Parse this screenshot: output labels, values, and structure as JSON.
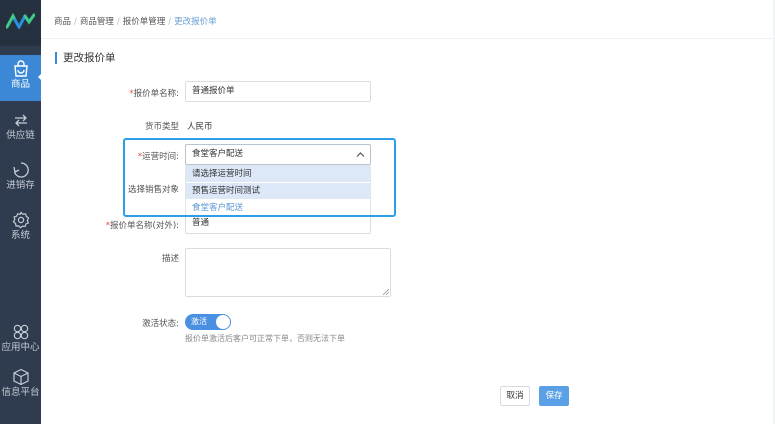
{
  "sidebar": {
    "items": [
      {
        "label": "商品",
        "icon": "shopping-bag-icon",
        "active": true
      },
      {
        "label": "供应链",
        "icon": "exchange-arrows-icon",
        "active": false
      },
      {
        "label": "进销存",
        "icon": "cycle-icon",
        "active": false
      },
      {
        "label": "系统",
        "icon": "gear-icon",
        "active": false
      },
      {
        "label": "应用中心",
        "icon": "apps-icon",
        "active": false
      },
      {
        "label": "信息平台",
        "icon": "cube-icon",
        "active": false
      }
    ]
  },
  "breadcrumb": [
    "商品",
    "商品管理",
    "报价单管理",
    "更改报价单"
  ],
  "page_title": "更改报价单",
  "form": {
    "name_label": "报价单名称:",
    "name_value": "普通报价单",
    "currency_label": "货币类型",
    "currency_value": "人民币",
    "time_label": "运营时间:",
    "time_value": "食堂客户配送",
    "time_options": [
      "请选择运营时间",
      "预售运营时间测试",
      "食堂客户配送"
    ],
    "sales_target_label": "选择销售对象",
    "external_name_label": "报价单名称(对外):",
    "external_name_value": "普通",
    "description_label": "描述",
    "status_label": "激活状态:",
    "status_value": "激活",
    "status_hint": "报价单激活后客户可正常下单，否则无法下单"
  },
  "buttons": {
    "cancel": "取消",
    "save": "保存"
  },
  "colors": {
    "sidebar_bg": "#2f3b4e",
    "accent": "#3d88d6",
    "required": "#e94b4b",
    "highlight_border": "#2f9ee8"
  }
}
